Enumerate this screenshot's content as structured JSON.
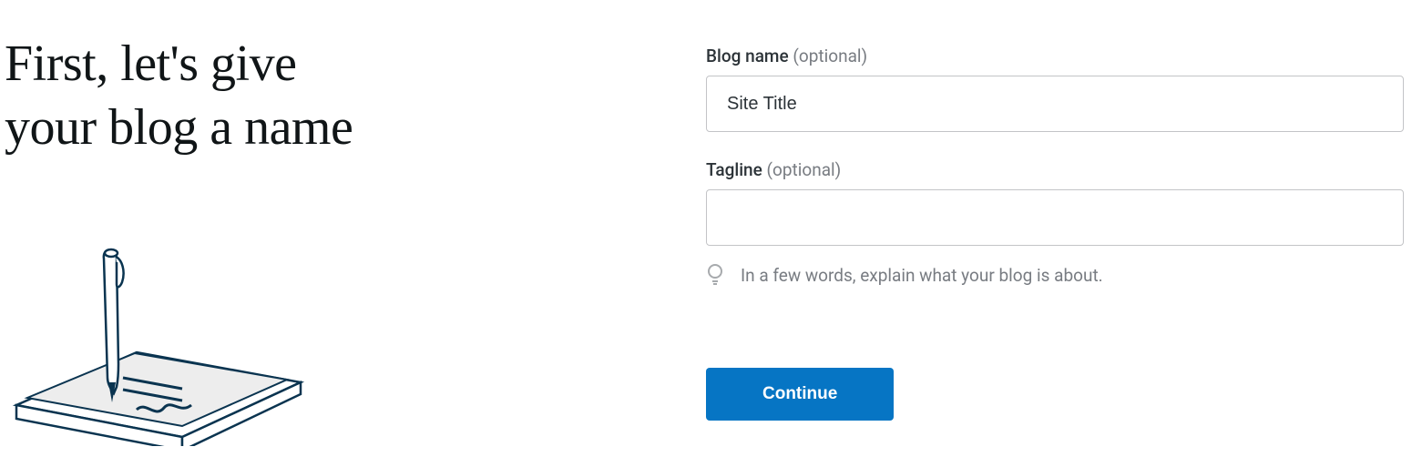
{
  "heading": {
    "line1": "First, let's give",
    "line2": "your blog a name"
  },
  "form": {
    "blog_name": {
      "label": "Blog name",
      "optional_text": "(optional)",
      "value": "Site Title"
    },
    "tagline": {
      "label": "Tagline",
      "optional_text": "(optional)",
      "value": "",
      "hint": "In a few words, explain what your blog is about."
    },
    "continue_label": "Continue"
  }
}
